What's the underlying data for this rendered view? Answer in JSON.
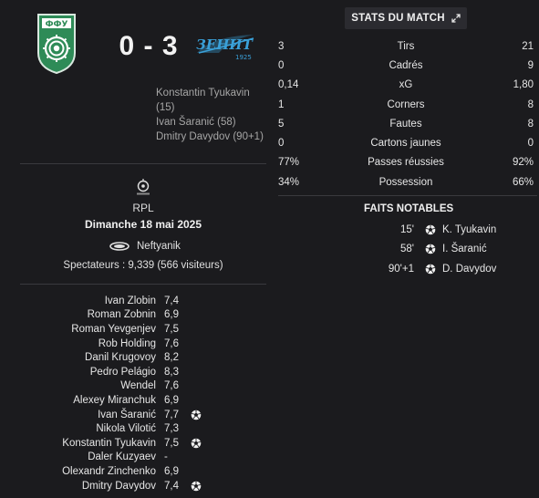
{
  "match": {
    "home_score": "0",
    "separator": "-",
    "away_score": "3",
    "scorers": [
      "Konstantin Tyukavin",
      "(15)",
      "Ivan Šaranić (58)",
      "Dmitry Davydov (90+1)"
    ],
    "league": "RPL",
    "date": "Dimanche 18 mai 2025",
    "stadium": "Neftyanik",
    "attendance": "Spectateurs : 9,339 (566 visiteurs)"
  },
  "home_crest_text": "ФФУ",
  "away_crest_text": "ЗЕНИТ",
  "away_crest_year": "1925",
  "players": [
    {
      "name": "Ivan Zlobin",
      "rating": "7,4",
      "goal": false
    },
    {
      "name": "Roman Zobnin",
      "rating": "6,9",
      "goal": false
    },
    {
      "name": "Roman Yevgenjev",
      "rating": "7,5",
      "goal": false
    },
    {
      "name": "Rob Holding",
      "rating": "7,6",
      "goal": false
    },
    {
      "name": "Danil Krugovoy",
      "rating": "8,2",
      "goal": false
    },
    {
      "name": "Pedro Pelágio",
      "rating": "8,3",
      "goal": false
    },
    {
      "name": "Wendel",
      "rating": "7,6",
      "goal": false
    },
    {
      "name": "Alexey Miranchuk",
      "rating": "6,9",
      "goal": false
    },
    {
      "name": "Ivan Šaranić",
      "rating": "7,7",
      "goal": true
    },
    {
      "name": "Nikola Vilotić",
      "rating": "7,3",
      "goal": false
    },
    {
      "name": "Konstantin Tyukavin",
      "rating": "7,5",
      "goal": true
    },
    {
      "name": "Daler Kuzyaev",
      "rating": "-",
      "goal": false
    },
    {
      "name": "Olexandr Zinchenko",
      "rating": "6,9",
      "goal": false
    },
    {
      "name": "Dmitry Davydov",
      "rating": "7,4",
      "goal": true
    }
  ],
  "stats_header": "STATS DU MATCH",
  "stats": [
    {
      "home": "3",
      "label": "Tirs",
      "away": "21"
    },
    {
      "home": "0",
      "label": "Cadrés",
      "away": "9"
    },
    {
      "home": "0,14",
      "label": "xG",
      "away": "1,80"
    },
    {
      "home": "1",
      "label": "Corners",
      "away": "8"
    },
    {
      "home": "5",
      "label": "Fautes",
      "away": "8"
    },
    {
      "home": "0",
      "label": "Cartons jaunes",
      "away": "0"
    },
    {
      "home": "77%",
      "label": "Passes réussies",
      "away": "92%"
    },
    {
      "home": "34%",
      "label": "Possession",
      "away": "66%"
    }
  ],
  "events_title": "FAITS NOTABLES",
  "events": [
    {
      "minute": "15'",
      "player": "K. Tyukavin"
    },
    {
      "minute": "58'",
      "player": "I. Šaranić"
    },
    {
      "minute": "90'+1",
      "player": "D. Davydov"
    }
  ],
  "colors": {
    "background": "#1b1b1e",
    "home_crest": "#2e8b57",
    "away_crest": "#3aa0d8"
  }
}
